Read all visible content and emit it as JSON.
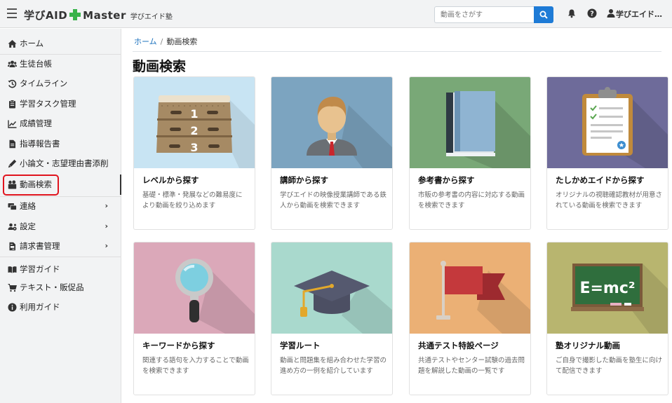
{
  "header": {
    "brand_name": "学びAID",
    "brand_suffix": "Master",
    "school_name": "学びエイド塾",
    "search_placeholder": "動画をさがす",
    "user_name": "学びエイド…"
  },
  "sidebar": {
    "items": [
      {
        "label": "ホーム",
        "icon": "home-icon"
      },
      {
        "label": "生徒台帳",
        "icon": "users-icon"
      },
      {
        "label": "タイムライン",
        "icon": "history-icon"
      },
      {
        "label": "学習タスク管理",
        "icon": "clipboard-icon"
      },
      {
        "label": "成績管理",
        "icon": "chart-line-icon"
      },
      {
        "label": "指導報告書",
        "icon": "file-icon"
      },
      {
        "label": "小論文・志望理由書添削",
        "icon": "pen-icon"
      },
      {
        "label": "動画検索",
        "icon": "video-search-icon"
      },
      {
        "label": "連絡",
        "icon": "message-icon"
      },
      {
        "label": "設定",
        "icon": "users-cog-icon"
      },
      {
        "label": "請求書管理",
        "icon": "invoice-icon"
      },
      {
        "label": "学習ガイド",
        "icon": "book-open-icon"
      },
      {
        "label": "テキスト・販促品",
        "icon": "cart-icon"
      },
      {
        "label": "利用ガイド",
        "icon": "info-icon"
      }
    ]
  },
  "breadcrumb": {
    "home": "ホーム",
    "separator": "/",
    "current": "動画検索"
  },
  "page_title": "動画検索",
  "cards": [
    {
      "title": "レベルから探す",
      "description": "基礎・標準・発展などの難易度により動画を絞り込めます",
      "bg": "#c8e4f3",
      "icon": "level-stand-icon"
    },
    {
      "title": "講師から探す",
      "description": "学びエイドの映像授業講師である鉄人から動画を検索できます",
      "bg": "#7ca4c0",
      "icon": "teacher-icon"
    },
    {
      "title": "参考書から探す",
      "description": "市販の参考書の内容に対応する動画を検索できます",
      "bg": "#79a877",
      "icon": "book-icon"
    },
    {
      "title": "たしかめエイドから探す",
      "description": "オリジナルの視聴確認教材が用意されている動画を検索できます",
      "bg": "#6e6b9a",
      "icon": "clipboard-check-icon"
    },
    {
      "title": "キーワードから探す",
      "description": "関連する語句を入力することで動画を検索できます",
      "bg": "#dba8b9",
      "icon": "magnifier-icon"
    },
    {
      "title": "学習ルート",
      "description": "動画と問題集を組み合わせた学習の進め方の一例を紹介しています",
      "bg": "#a9d9cd",
      "icon": "graduation-cap-icon"
    },
    {
      "title": "共通テスト特設ページ",
      "description": "共通テストやセンター試験の過去問題を解説した動画の一覧です",
      "bg": "#ebb075",
      "icon": "flag-icon"
    },
    {
      "title": "塾オリジナル動画",
      "description": "ご自身で撮影した動画を塾生に向けて配信できます",
      "bg": "#b8b56f",
      "icon": "blackboard-icon",
      "board_text": "E=mc²"
    }
  ],
  "level_numbers": [
    "1",
    "2",
    "3"
  ]
}
